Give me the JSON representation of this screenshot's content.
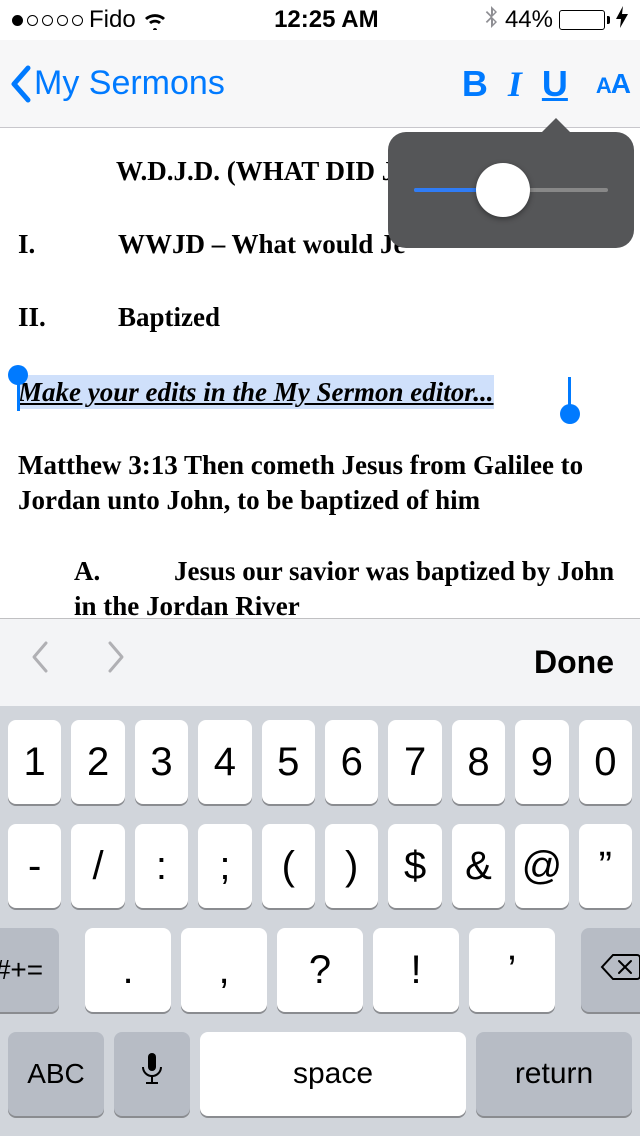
{
  "status": {
    "carrier": "Fido",
    "time": "12:25 AM",
    "battery_pct": "44%"
  },
  "nav": {
    "back_label": "My Sermons",
    "bold": "B",
    "italic": "I",
    "underline": "U",
    "text_size_small": "A",
    "text_size_large": "A"
  },
  "doc": {
    "title": "W.D.J.D. (WHAT DID JE",
    "section1_num": "I.",
    "section1_text": "WWJD – What would Je",
    "section2_num": "II.",
    "section2_text": "Baptized",
    "selected_text": "Make your edits in the My Sermon editor...",
    "verse": "Matthew 3:13 Then cometh Jesus from Galilee to Jordan unto John, to be baptized of him",
    "sub_label": "A.",
    "sub_text": "Jesus our savior was baptized by John in the Jordan River"
  },
  "slider": {
    "value_pct": 46
  },
  "accessory": {
    "done": "Done"
  },
  "keyboard": {
    "row1": [
      "1",
      "2",
      "3",
      "4",
      "5",
      "6",
      "7",
      "8",
      "9",
      "0"
    ],
    "row2": [
      "-",
      "/",
      ":",
      ";",
      "(",
      ")",
      "$",
      "&",
      "@",
      "”"
    ],
    "sym": "#+=",
    "row3": [
      ".",
      ",",
      "?",
      "!",
      "’"
    ],
    "abc": "ABC",
    "space": "space",
    "return": "return"
  }
}
